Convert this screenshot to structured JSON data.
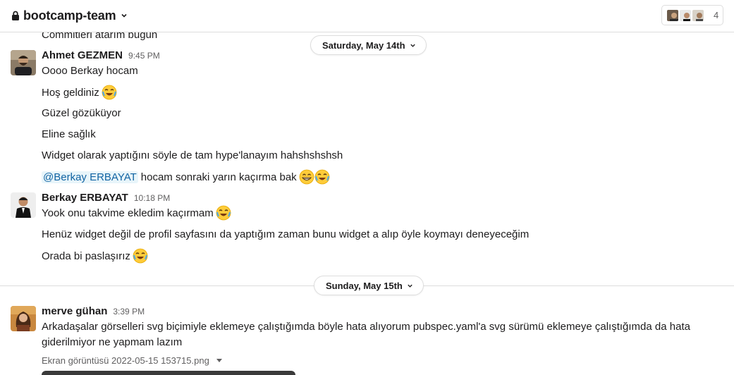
{
  "header": {
    "channel_name": "bootcamp-team",
    "member_count": "4"
  },
  "scroll_cut_text": "Commitleri atarım bugün",
  "dividers": [
    {
      "label": "Saturday, May 14th"
    },
    {
      "label": "Sunday, May 15th"
    }
  ],
  "messages": [
    {
      "sender": "Ahmet GEZMEN",
      "time": "9:45 PM",
      "lines": [
        "Oooo Berkay hocam",
        "Hoş geldiniz",
        "Güzel gözüküyor",
        "Eline sağlık",
        "Widget olarak yaptığını söyle de tam hype'lanayım hahshshshsh"
      ],
      "mention": "@Berkay ERBAYAT",
      "mention_text": "hocam sonraki yarın kaçırma bak"
    },
    {
      "sender": "Berkay ERBAYAT",
      "time": "10:18 PM",
      "lines": [
        "Yook onu takvime ekledim kaçırmam",
        "Henüz widget değil de profil sayfasını da yaptığım zaman bunu widget a alıp öyle koymayı deneyeceğim",
        "Orada bi paslaşırız"
      ]
    },
    {
      "sender": "merve gühan",
      "time": "3:39 PM",
      "lines": [
        "Arkadaşalar görselleri svg biçimiyle eklemeye çalıştığımda böyle hata alıyorum pubspec.yaml'a svg sürümü eklemeye çalıştığımda da hata giderilmiyor ne yapmam lazım"
      ],
      "file_name": "Ekran görüntüsü 2022-05-15 153715.png"
    }
  ],
  "emoji": {
    "joy": "face-with-tears-of-joy",
    "grin": "grinning-face-with-smiling-eyes"
  },
  "colors": {
    "mention_bg": "#e8f5fa",
    "mention_fg": "#1264a3",
    "divider": "#dddddd",
    "muted": "#616061"
  }
}
